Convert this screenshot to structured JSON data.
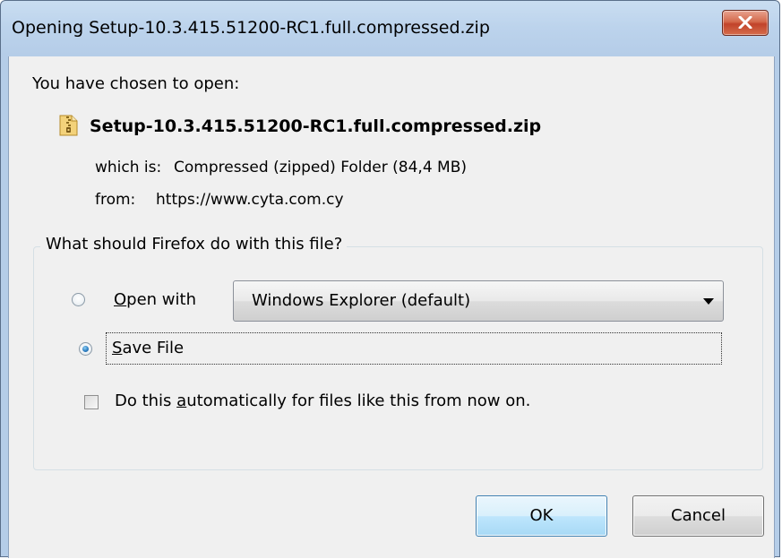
{
  "window": {
    "title": "Opening Setup-10.3.415.51200-RC1.full.compressed.zip"
  },
  "dialog": {
    "intro": "You have chosen to open:",
    "file_icon": "zip-file-icon",
    "filename": "Setup-10.3.415.51200-RC1.full.compressed.zip",
    "which_is_label": "which is:",
    "which_is_value": "Compressed (zipped) Folder (84,4 MB)",
    "from_label": "from:",
    "from_value": "https://www.cyta.com.cy"
  },
  "action_group": {
    "legend": "What should Firefox do with this file?",
    "open_with": {
      "label_mnemonic": "O",
      "label_rest": "pen with",
      "selected": false,
      "app_selected": "Windows Explorer (default)"
    },
    "save_file": {
      "label_mnemonic": "S",
      "label_rest": "ave File",
      "selected": true
    },
    "auto": {
      "label_pre": "Do this ",
      "label_mnemonic": "a",
      "label_post": "utomatically for files like this from now on.",
      "checked": false
    }
  },
  "buttons": {
    "ok": "OK",
    "cancel": "Cancel"
  },
  "colors": {
    "title_bar": "#bcd3ec",
    "close_button": "#c1432a",
    "dialog_bg": "#f0f0f0",
    "radio_selected": "#2f7fc2"
  }
}
